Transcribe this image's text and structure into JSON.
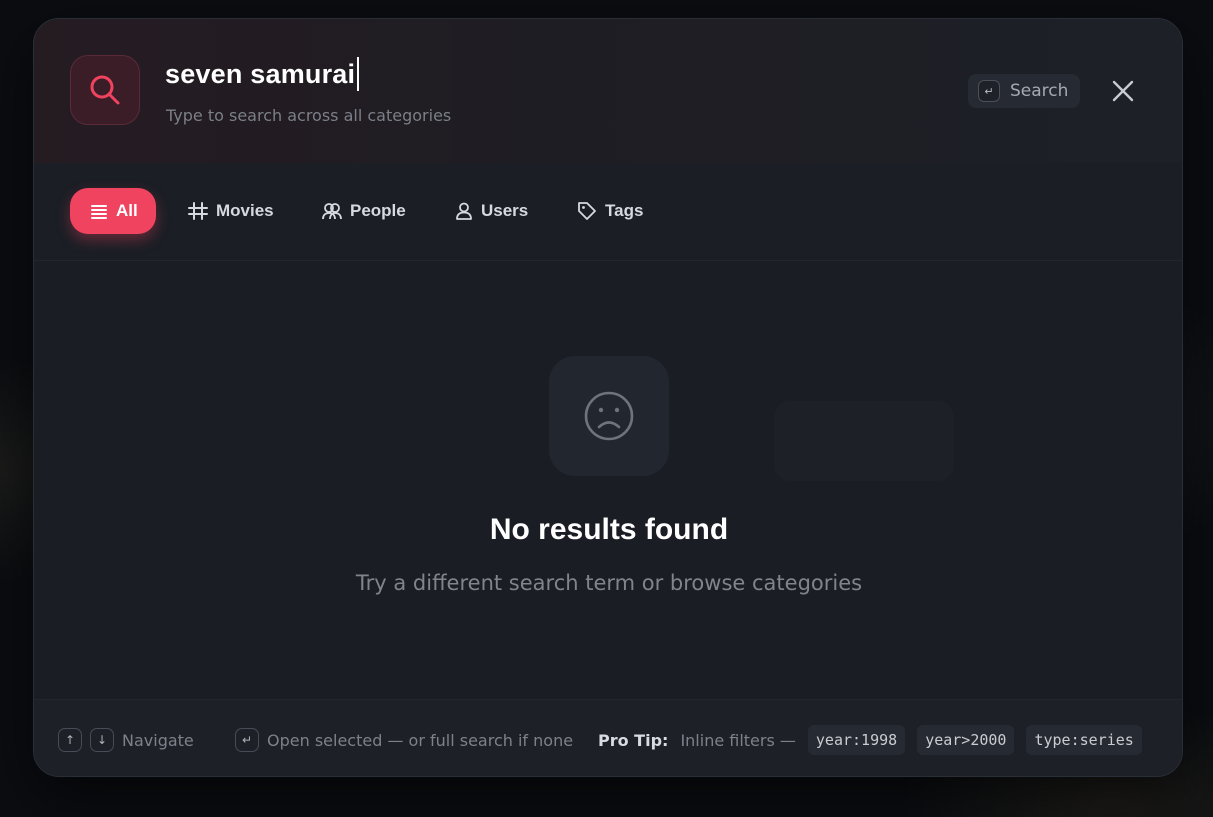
{
  "search": {
    "query": "seven samurai",
    "subtitle": "Type to search across all categories",
    "button_label": "Search",
    "enter_key": "↵"
  },
  "tabs": [
    {
      "label": "All",
      "icon": "list-icon",
      "active": true
    },
    {
      "label": "Movies",
      "icon": "hash-icon",
      "active": false
    },
    {
      "label": "People",
      "icon": "people-icon",
      "active": false
    },
    {
      "label": "Users",
      "icon": "user-icon",
      "active": false
    },
    {
      "label": "Tags",
      "icon": "tag-icon",
      "active": false
    }
  ],
  "empty_state": {
    "icon": "sad-face-icon",
    "title": "No results found",
    "subtitle": "Try a different search term or browse categories"
  },
  "footer": {
    "up_key": "↑",
    "down_key": "↓",
    "navigate_label": "Navigate",
    "enter_key": "↵",
    "open_label": "Open selected — or full search if none",
    "pro_tip_label": "Pro Tip:",
    "pro_tip_text": "Inline filters —",
    "filters": [
      "year:1998",
      "year>2000",
      "type:series"
    ]
  },
  "colors": {
    "accent": "#f0435f",
    "background": "#1a1d24",
    "text_muted": "#7b7f88"
  }
}
